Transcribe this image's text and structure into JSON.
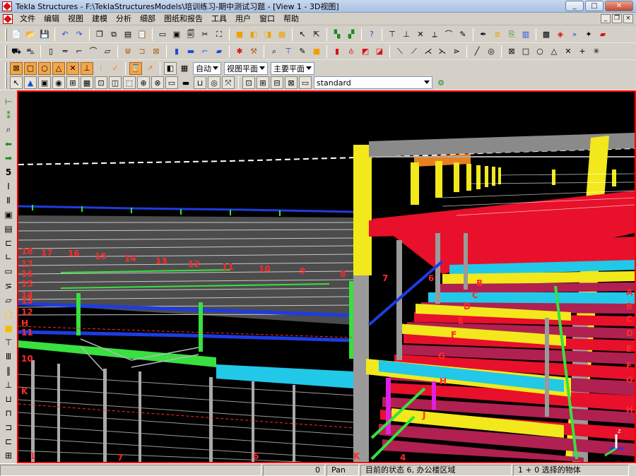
{
  "window": {
    "title": "Tekla Structures - F:\\TeklaStructuresModels\\培训练习-期中测试习题 - [View 1 - 3D视图]",
    "buttons": {
      "minimize": "_",
      "maximize": "□",
      "close": "✕"
    }
  },
  "menu": {
    "items": [
      "文件",
      "编辑",
      "视图",
      "建模",
      "分析",
      "细部",
      "图纸和报告",
      "工具",
      "用户",
      "窗口",
      "帮助"
    ],
    "mdi_buttons": {
      "minimize": "_",
      "restore": "❐",
      "close": "×"
    }
  },
  "toolbars": {
    "dropdown_auto": "自动",
    "dropdown_view_plane": "视图平面",
    "dropdown_main_plane": "主要平面",
    "dropdown_standard": "standard"
  },
  "viewport": {
    "axis_labels_top_left": [
      "18",
      "17",
      "16",
      "15",
      "14",
      "13",
      "12",
      "11",
      "10",
      "9",
      "8",
      "7"
    ],
    "axis_labels_left_column": [
      "18",
      "17",
      "16",
      "15",
      "14",
      "13",
      "12",
      "H",
      "11",
      "10",
      "K"
    ],
    "axis_labels_bottom": [
      "1",
      "7",
      "6",
      "K",
      "4"
    ],
    "axis_labels_right_letters": [
      "A",
      "B",
      "C",
      "D",
      "E",
      "F",
      "G",
      "H"
    ],
    "axis_labels_right_interior": [
      "B",
      "C",
      "D",
      "E",
      "F",
      "G",
      "H",
      "J"
    ],
    "axis_labels_right_edge": [
      "A",
      "B",
      "C",
      "D",
      "E",
      "F",
      "G",
      "H"
    ],
    "axis_label_6": "6"
  },
  "status": {
    "value": "0",
    "mode": "Pan",
    "current_state": "目前的状态 6, 办公楼区域",
    "selection": "1 + 0 选择的物体"
  },
  "colors": {
    "viewport_border": "#ff0000",
    "background": "#000000",
    "column_yellow": "#f2e81c",
    "beam_red": "#e8102a",
    "beam_cyan": "#22c8e8",
    "beam_green": "#38e040",
    "beam_blue": "#1e3ce0",
    "grid_label": "#ff2a2a"
  }
}
